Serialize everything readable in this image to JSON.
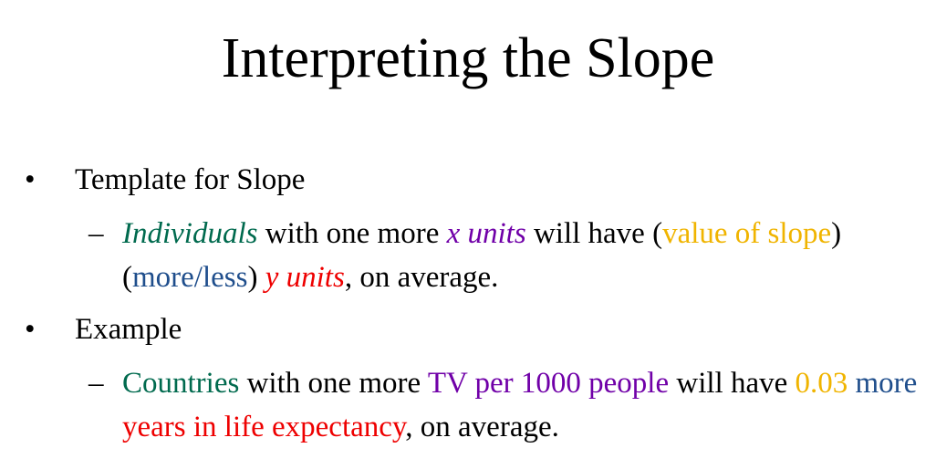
{
  "slide": {
    "title": "Interpreting the Slope",
    "bullets": [
      {
        "marker": "•",
        "label": "Template for Slope",
        "sub": {
          "marker": "–",
          "segments": [
            {
              "text": "Individuals",
              "color": "#006a4e",
              "italic": true
            },
            {
              "text": " with one more ",
              "color": "#000000",
              "italic": false
            },
            {
              "text": "x units",
              "color": "#7000a8",
              "italic": true
            },
            {
              "text": " will have (",
              "color": "#000000",
              "italic": false
            },
            {
              "text": "value of slope",
              "color": "#f0b400",
              "italic": false
            },
            {
              "text": ") (",
              "color": "#000000",
              "italic": false
            },
            {
              "text": "more/less",
              "color": "#1f4e8c",
              "italic": false
            },
            {
              "text": ") ",
              "color": "#000000",
              "italic": false
            },
            {
              "text": "y units",
              "color": "#ee0000",
              "italic": true
            },
            {
              "text": ", on average.",
              "color": "#000000",
              "italic": false
            }
          ]
        }
      },
      {
        "marker": "•",
        "label": "Example",
        "sub": {
          "marker": "–",
          "segments": [
            {
              "text": "Countries",
              "color": "#006a4e",
              "italic": false
            },
            {
              "text": " with one more ",
              "color": "#000000",
              "italic": false
            },
            {
              "text": "TV per 1000 people",
              "color": "#7000a8",
              "italic": false
            },
            {
              "text": " will have ",
              "color": "#000000",
              "italic": false
            },
            {
              "text": "0.03",
              "color": "#f0b400",
              "italic": false
            },
            {
              "text": " ",
              "color": "#000000",
              "italic": false
            },
            {
              "text": "more",
              "color": "#1f4e8c",
              "italic": false
            },
            {
              "text": " ",
              "color": "#000000",
              "italic": false
            },
            {
              "text": "years in life expectancy",
              "color": "#ee0000",
              "italic": false
            },
            {
              "text": ", on average.",
              "color": "#000000",
              "italic": false
            }
          ]
        }
      }
    ]
  }
}
